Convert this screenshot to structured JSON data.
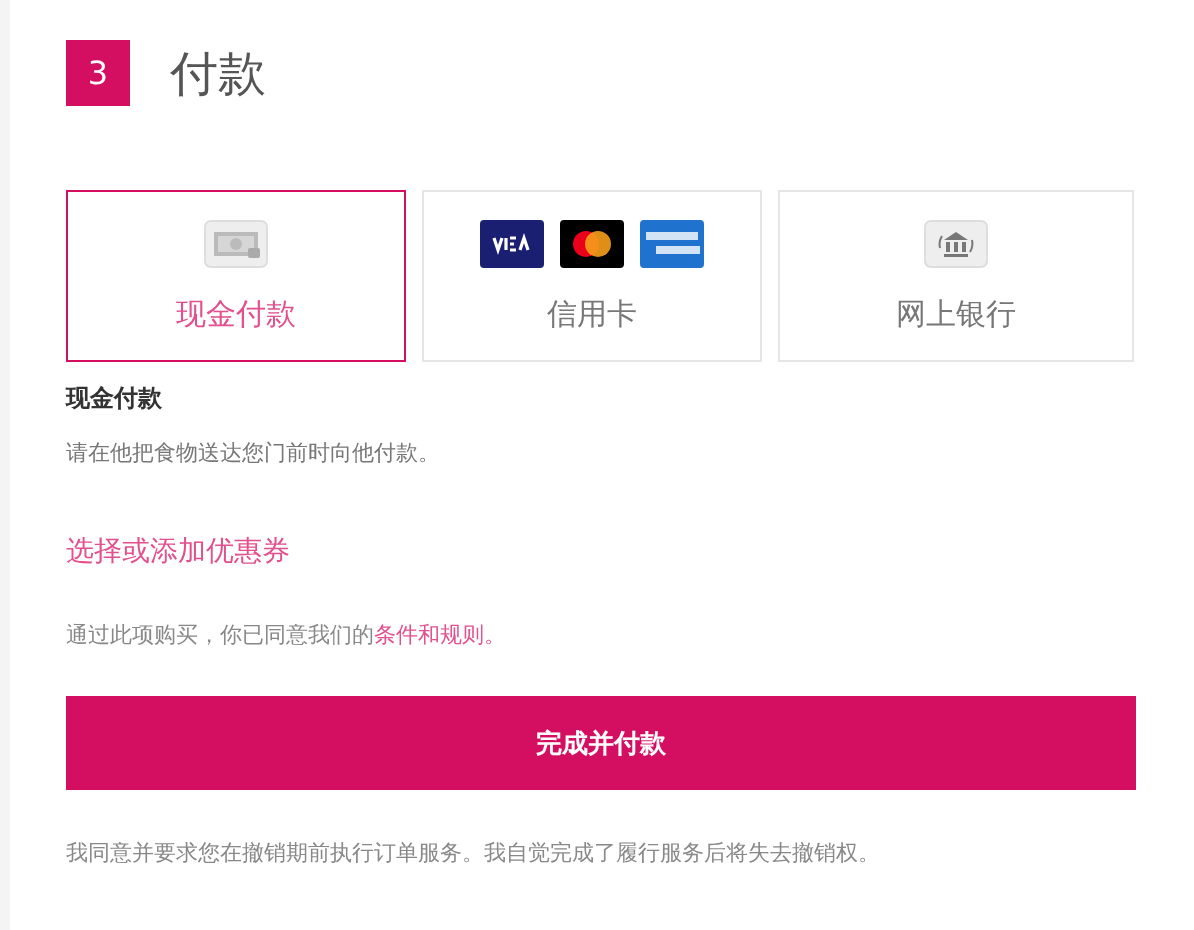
{
  "step": {
    "number": "3",
    "title": "付款"
  },
  "methods": [
    {
      "kind": "cash",
      "label": "现金付款",
      "selected": true
    },
    {
      "kind": "cards",
      "label": "信用卡",
      "selected": false
    },
    {
      "kind": "bank",
      "label": "网上银行",
      "selected": false
    }
  ],
  "method_heading": "现金付款",
  "method_description": "请在他把食物送达您门前时向他付款。",
  "coupon_link": "选择或添加优惠券",
  "terms": {
    "text": "通过此项购买，你已同意我们的",
    "link": "条件和规则。"
  },
  "submit_button": "完成并付款",
  "footnote": "我同意并要求您在撤销期前执行订单服务。我自觉完成了履行服务后将失去撤销权。"
}
